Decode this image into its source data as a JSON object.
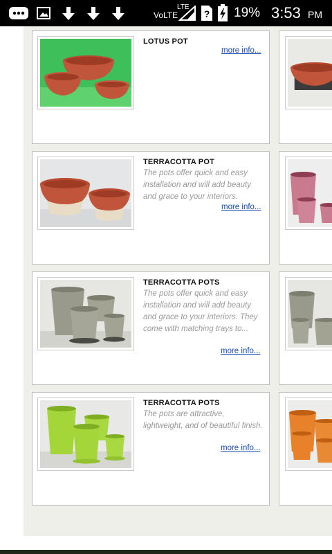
{
  "status_bar": {
    "network_label": "VoLTE",
    "lte_label": "LTE",
    "battery_percent": "19%",
    "time": "3:53",
    "ampm": "PM"
  },
  "products": [
    {
      "title": "LOTUS POT",
      "description": "",
      "more_label": "more info..."
    },
    {
      "title": "TERRACOTTA POT",
      "description": "The pots offer quick and easy installation and will add beauty and grace to your interiors.",
      "more_label": "more info..."
    },
    {
      "title": "TERRACOTTA POTS",
      "description": "The pots offer quick and easy installation and will add beauty and grace to your interiors. They come with matching trays to...",
      "more_label": "more info..."
    },
    {
      "title": "TERRACOTTA POTS",
      "description": "The pots are attractive, lightweight, and of beautiful finish.",
      "more_label": "more info..."
    }
  ],
  "colors": {
    "link": "#1a4db3",
    "terracotta": "#c0553a",
    "green_backdrop": "#3fbf5a",
    "lime_pot": "#a4d63a",
    "grey_pot": "#9a9a8c",
    "pink_pot": "#c97a8e",
    "orange_pot": "#e8822a"
  }
}
